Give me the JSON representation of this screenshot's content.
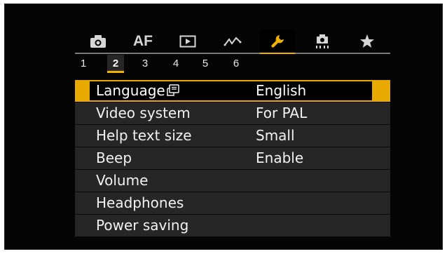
{
  "tabs": [
    {
      "icon": "camera-icon",
      "active": false
    },
    {
      "label": "AF",
      "active": false
    },
    {
      "icon": "playback-icon",
      "active": false
    },
    {
      "icon": "wireless-icon",
      "active": false
    },
    {
      "icon": "wrench-icon",
      "active": true
    },
    {
      "icon": "custom-function-icon",
      "active": false
    },
    {
      "icon": "star-icon",
      "active": false
    }
  ],
  "pages": [
    "1",
    "2",
    "3",
    "4",
    "5",
    "6"
  ],
  "active_page": "2",
  "menu": {
    "items": [
      {
        "label": "Language",
        "value": "English",
        "selected": true
      },
      {
        "label": "Video system",
        "value": "For PAL"
      },
      {
        "label": "Help text size",
        "value": "Small"
      },
      {
        "label": "Beep",
        "value": "Enable"
      },
      {
        "label": "Volume",
        "value": ""
      },
      {
        "label": "Headphones",
        "value": ""
      },
      {
        "label": "Power saving",
        "value": ""
      }
    ]
  },
  "colors": {
    "accent": "#f2b000",
    "row_bg": "#262626",
    "screen_bg": "#050505"
  }
}
